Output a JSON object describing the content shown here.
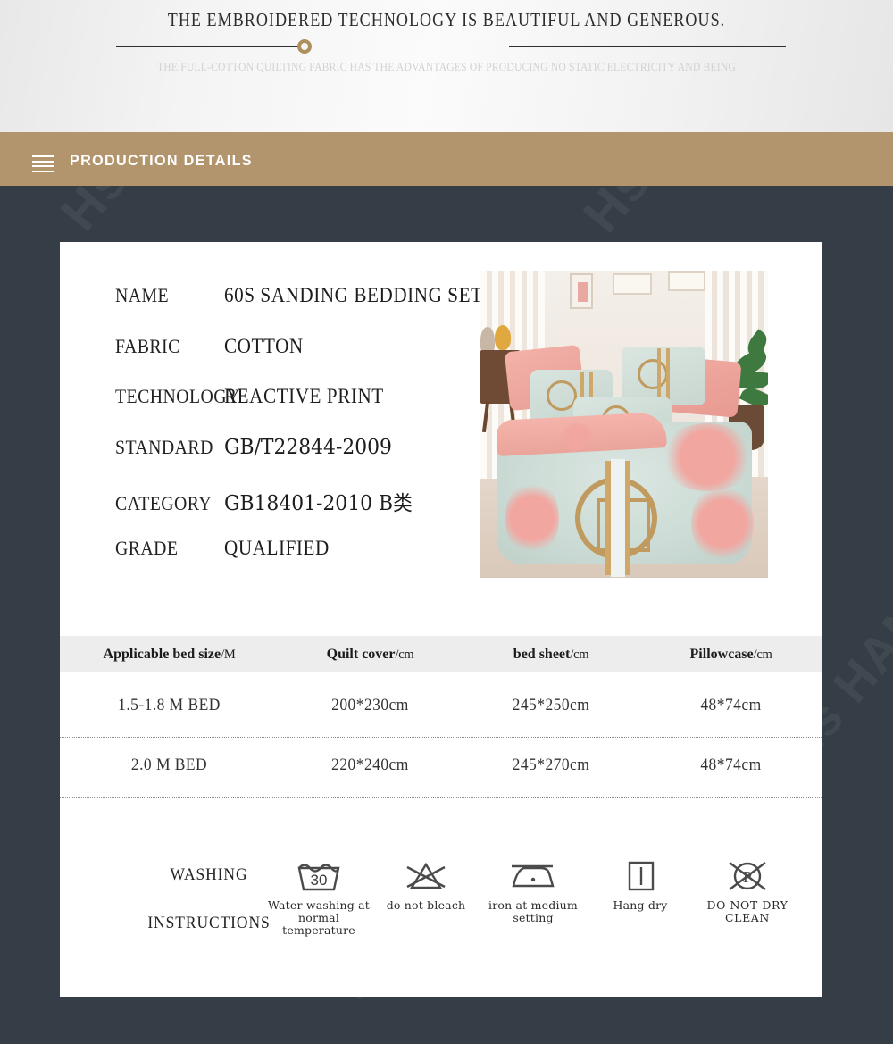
{
  "hero": {
    "title": "THE EMBROIDERED TECHNOLOGY IS BEAUTIFUL AND GENEROUS.",
    "subtitle": "THE FULL-COTTON QUILTING FABRIC HAS THE ADVANTAGES OF PRODUCING NO STATIC ELECTRICITY AND BEING",
    "accent_color": "#ae8f5e"
  },
  "section_bar": {
    "title": "PRODUCTION DETAILS",
    "menu_icon": "hamburger-icon",
    "background_color": "#b2956d",
    "text_color": "#ffffff"
  },
  "page": {
    "background_color": "#353e46",
    "card_color": "#ffffff",
    "watermark": "Hs HANSEN"
  },
  "specs": [
    {
      "key": "NAME",
      "value": "60S SANDING BEDDING SET",
      "style": "plain"
    },
    {
      "key": "FABRIC",
      "value": "COTTON",
      "style": "plain"
    },
    {
      "key": "TECHNOLOGY",
      "value": "REACTIVE PRINT",
      "style": "plain"
    },
    {
      "key": "STANDARD",
      "value": "GB/T22844-2009",
      "style": "alt"
    },
    {
      "key": "CATEGORY",
      "value": "GB18401-2010 B类",
      "style": "alt"
    },
    {
      "key": "GRADE",
      "value": "QUALIFIED",
      "style": "plain"
    }
  ],
  "product_image": {
    "alt": "bedroom scene with pink and mint floral bedding set",
    "name": "product-photo"
  },
  "size_table": {
    "headers": [
      {
        "label": "Applicable bed size",
        "unit": "/M"
      },
      {
        "label": "Quilt cover",
        "unit": "/cm"
      },
      {
        "label": "bed sheet",
        "unit": "/cm"
      },
      {
        "label": "Pillowcase",
        "unit": "/cm"
      }
    ],
    "rows": [
      {
        "bed_size": "1.5-1.8 M BED",
        "quilt_cover": "200*230cm",
        "bed_sheet": "245*250cm",
        "pillowcase": "48*74cm"
      },
      {
        "bed_size": "2.0 M BED",
        "quilt_cover": "220*240cm",
        "bed_sheet": "245*270cm",
        "pillowcase": "48*74cm"
      }
    ],
    "header_background": "#ededed"
  },
  "washing": {
    "label_line1": "WASHING",
    "label_line2": "INSTRUCTIONS",
    "icons": [
      {
        "icon": "wash-30-tub-icon",
        "temperature": "30",
        "caption": "Water washing at normal temperature"
      },
      {
        "icon": "do-not-bleach-icon",
        "caption": "do not bleach"
      },
      {
        "icon": "iron-medium-icon",
        "caption": "iron at medium setting"
      },
      {
        "icon": "hang-dry-icon",
        "caption": "Hang dry"
      },
      {
        "icon": "do-not-dry-clean-icon",
        "caption": "DO NOT DRY CLEAN"
      }
    ]
  }
}
